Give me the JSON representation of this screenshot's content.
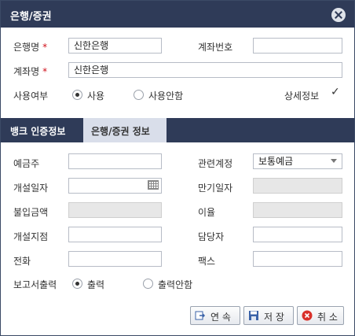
{
  "dialog": {
    "title": "은행/증권"
  },
  "bank": {
    "bank_name_label": "은행명",
    "bank_name_value": "신한은행",
    "required_mark": "*",
    "account_no_label": "계좌번호",
    "account_no_value": "",
    "account_name_label": "계좌명",
    "account_name_value": "신한은행",
    "use_label": "사용여부",
    "use_yes": "사용",
    "use_no": "사용안함",
    "use_selected": "사용",
    "detail_label": "상세정보",
    "detail_checked": true
  },
  "tabs": [
    {
      "label": "뱅크 인증정보",
      "active": false
    },
    {
      "label": "은행/증권 정보",
      "active": true
    }
  ],
  "info": {
    "depositor_label": "예금주",
    "depositor_value": "",
    "related_account_label": "관련계정",
    "related_account_value": "보통예금",
    "open_date_label": "개설일자",
    "open_date_value": "",
    "maturity_label": "만기일자",
    "maturity_value": "",
    "deposit_amount_label": "불입금액",
    "deposit_amount_value": "",
    "rate_label": "이율",
    "rate_value": "",
    "branch_label": "개설지점",
    "branch_value": "",
    "manager_label": "담당자",
    "manager_value": "",
    "phone_label": "전화",
    "phone_value": "",
    "fax_label": "팩스",
    "fax_value": "",
    "report_label": "보고서출력",
    "report_yes": "출력",
    "report_no": "출력안함",
    "report_selected": "출력"
  },
  "buttons": {
    "continue": "연 속",
    "save": "저 장",
    "cancel": "취 소"
  },
  "icons": {
    "close": "close-icon",
    "calendar": "calendar-icon",
    "checkmark": "checkmark-icon",
    "continue": "continue-icon",
    "save": "floppy-disk-icon",
    "cancel": "cancel-icon"
  }
}
